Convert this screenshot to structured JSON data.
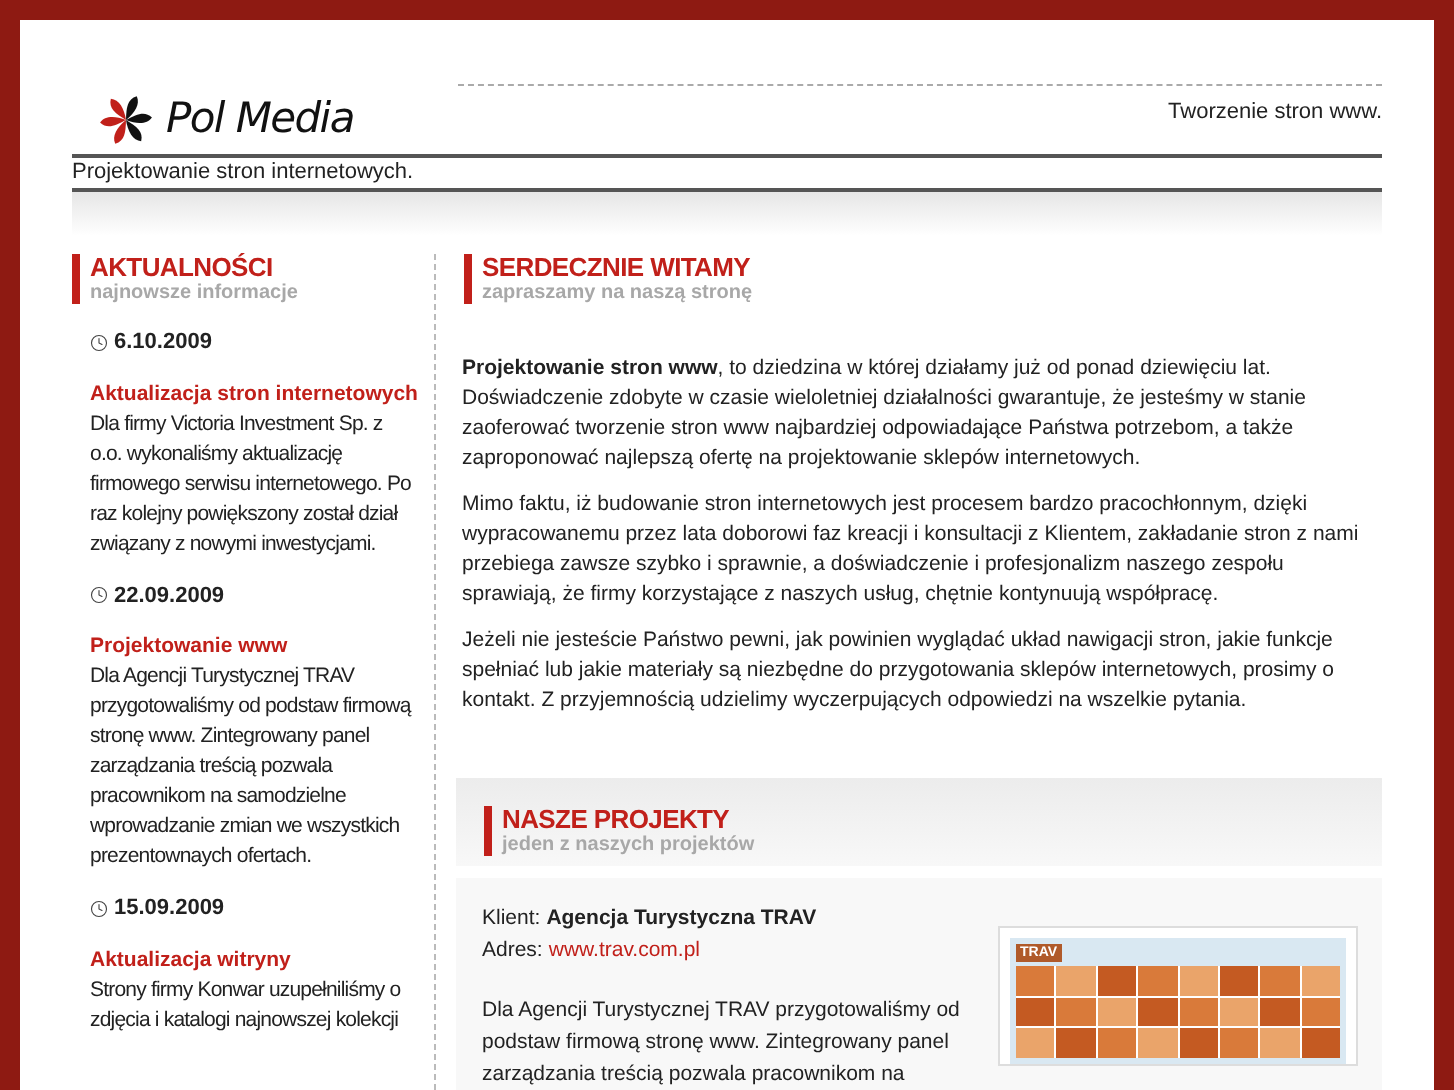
{
  "header": {
    "logo_text": "Pol Media",
    "tagline": "Tworzenie stron www.",
    "subtitle": "Projektowanie stron internetowych."
  },
  "news": {
    "title": "AKTUALNOŚCI",
    "subtitle": "najnowsze informacje",
    "items": [
      {
        "date": "6.10.2009",
        "title": "Aktualizacja stron internetowych",
        "text": "Dla firmy Victoria Investment Sp. z o.o. wykonaliśmy aktualizację firmowego serwisu internetowego. Po raz kolejny powiększony został dział związany z nowymi inwestycjami."
      },
      {
        "date": "22.09.2009",
        "title": "Projektowanie www",
        "text": "Dla Agencji Turystycznej TRAV przygotowaliśmy od podstaw firmową stronę www. Zintegrowany panel zarządzania treścią pozwala pracownikom na samodzielne wprowadzanie zmian we wszystkich prezentownaych ofertach."
      },
      {
        "date": "15.09.2009",
        "title": "Aktualizacja witryny",
        "text": "Strony firmy Konwar uzupełniliśmy o zdjęcia i katalogi najnowszej kolekcji"
      }
    ]
  },
  "welcome": {
    "title": "SERDECZNIE WITAMY",
    "subtitle": "zapraszamy na naszą stronę",
    "paragraphs": [
      "**Projektowanie stron www**, to dziedzina w której działamy już od ponad dziewięciu lat. Doświadczenie zdobyte w czasie wieloletniej działalności gwarantuje, że jesteśmy w stanie zaoferować tworzenie stron www najbardziej odpowiadające Państwa potrzebom, a także zaproponować najlepszą ofertę na projektowanie sklepów internetowych.",
      "Mimo faktu, iż budowanie stron internetowych jest procesem bardzo pracochłonnym, dzięki wypracowanemu przez lata doborowi faz kreacji i konsultacji z Klientem, zakładanie stron z nami przebiega zawsze szybko i sprawnie, a doświadczenie i profesjonalizm naszego zespołu sprawiają, że firmy korzystające z naszych usług, chętnie kontynuują współpracę.",
      "Jeżeli nie jesteście Państwo pewni, jak powinien wyglądać układ nawigacji stron, jakie funkcje spełniać lub jakie materiały są niezbędne do przygotowania sklepów internetowych, prosimy o kontakt. Z przyjemnością udzielimy wyczerpujących odpowiedzi na wszelkie pytania."
    ]
  },
  "projects": {
    "title": "NASZE PROJEKTY",
    "subtitle": "jeden z naszych projektów",
    "client_label": "Klient:",
    "client": "Agencja Turystyczna TRAV",
    "address_label": "Adres:",
    "address": "www.trav.com.pl",
    "text": "Dla Agencji Turystycznej TRAV przygotowaliśmy od podstaw firmową stronę www. Zintegrowany panel zarządzania treścią pozwala pracownikom na",
    "thumb_logo": "TRAV"
  }
}
